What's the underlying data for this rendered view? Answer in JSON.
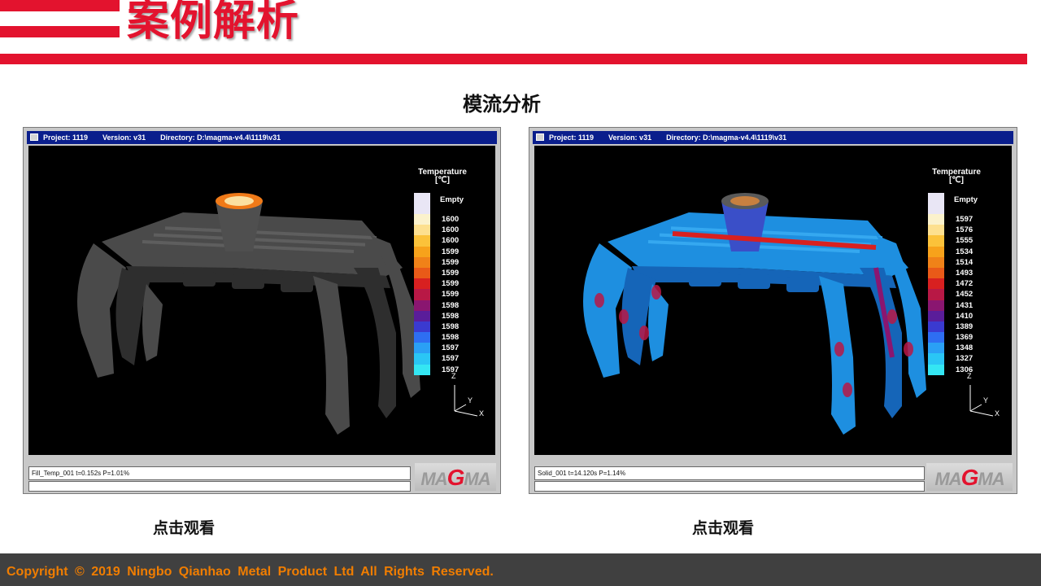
{
  "header": {
    "title": "案例解析",
    "accent_color": "#e3132e"
  },
  "section_title": "模流分析",
  "panels": [
    {
      "titlebar": {
        "project": "Project: 1119",
        "version": "Version: v31",
        "directory": "Directory: D:\\magma-v4.4\\1119\\v31"
      },
      "legend_title": "Temperature",
      "legend_unit": "[℃]",
      "legend_items": [
        {
          "label": "Empty",
          "color": "#e9e6f5"
        },
        {
          "label": "1600",
          "color": "#fbf2cc"
        },
        {
          "label": "1600",
          "color": "#fde08f"
        },
        {
          "label": "1600",
          "color": "#fbc23a"
        },
        {
          "label": "1599",
          "color": "#f7a21b"
        },
        {
          "label": "1599",
          "color": "#f08218"
        },
        {
          "label": "1599",
          "color": "#e95a18"
        },
        {
          "label": "1599",
          "color": "#d82020"
        },
        {
          "label": "1599",
          "color": "#b81845"
        },
        {
          "label": "1598",
          "color": "#8a1670"
        },
        {
          "label": "1598",
          "color": "#5a1d9a"
        },
        {
          "label": "1598",
          "color": "#3a3ad0"
        },
        {
          "label": "1598",
          "color": "#2e6ef2"
        },
        {
          "label": "1597",
          "color": "#2aa0f5"
        },
        {
          "label": "1597",
          "color": "#2ac6f5"
        },
        {
          "label": "1597",
          "color": "#34e6f3"
        }
      ],
      "axis_labels": {
        "z": "Z",
        "y": "Y",
        "x": "X"
      },
      "status_text": "Fill_Temp_001 t=0.152s P=1.01%",
      "logo": {
        "pre": "MA",
        "g": "G",
        "post": "MA"
      },
      "casting_color": "#4a4a4a",
      "caption": "点击观看"
    },
    {
      "titlebar": {
        "project": "Project: 1119",
        "version": "Version: v31",
        "directory": "Directory: D:\\magma-v4.4\\1119\\v31"
      },
      "legend_title": "Temperature",
      "legend_unit": "[℃]",
      "legend_items": [
        {
          "label": "Empty",
          "color": "#e9e6f5"
        },
        {
          "label": "1597",
          "color": "#fbf2cc"
        },
        {
          "label": "1576",
          "color": "#fde08f"
        },
        {
          "label": "1555",
          "color": "#fbc23a"
        },
        {
          "label": "1534",
          "color": "#f7a21b"
        },
        {
          "label": "1514",
          "color": "#f08218"
        },
        {
          "label": "1493",
          "color": "#e95a18"
        },
        {
          "label": "1472",
          "color": "#d82020"
        },
        {
          "label": "1452",
          "color": "#b81845"
        },
        {
          "label": "1431",
          "color": "#8a1670"
        },
        {
          "label": "1410",
          "color": "#5a1d9a"
        },
        {
          "label": "1389",
          "color": "#3a3ad0"
        },
        {
          "label": "1369",
          "color": "#2e6ef2"
        },
        {
          "label": "1348",
          "color": "#2aa0f5"
        },
        {
          "label": "1327",
          "color": "#2ac6f5"
        },
        {
          "label": "1306",
          "color": "#34e6f3"
        }
      ],
      "axis_labels": {
        "z": "Z",
        "y": "Y",
        "x": "X"
      },
      "status_text": "Solid_001 t=14.120s P=1.14%",
      "logo": {
        "pre": "MA",
        "g": "G",
        "post": "MA"
      },
      "casting_color": "#1e8fe0",
      "caption": "点击观看"
    }
  ],
  "footer": {
    "text": "Copyright © 2019 Ningbo Qianhao Metal Product Ltd All Rights Reserved.",
    "color": "#f07d00"
  }
}
